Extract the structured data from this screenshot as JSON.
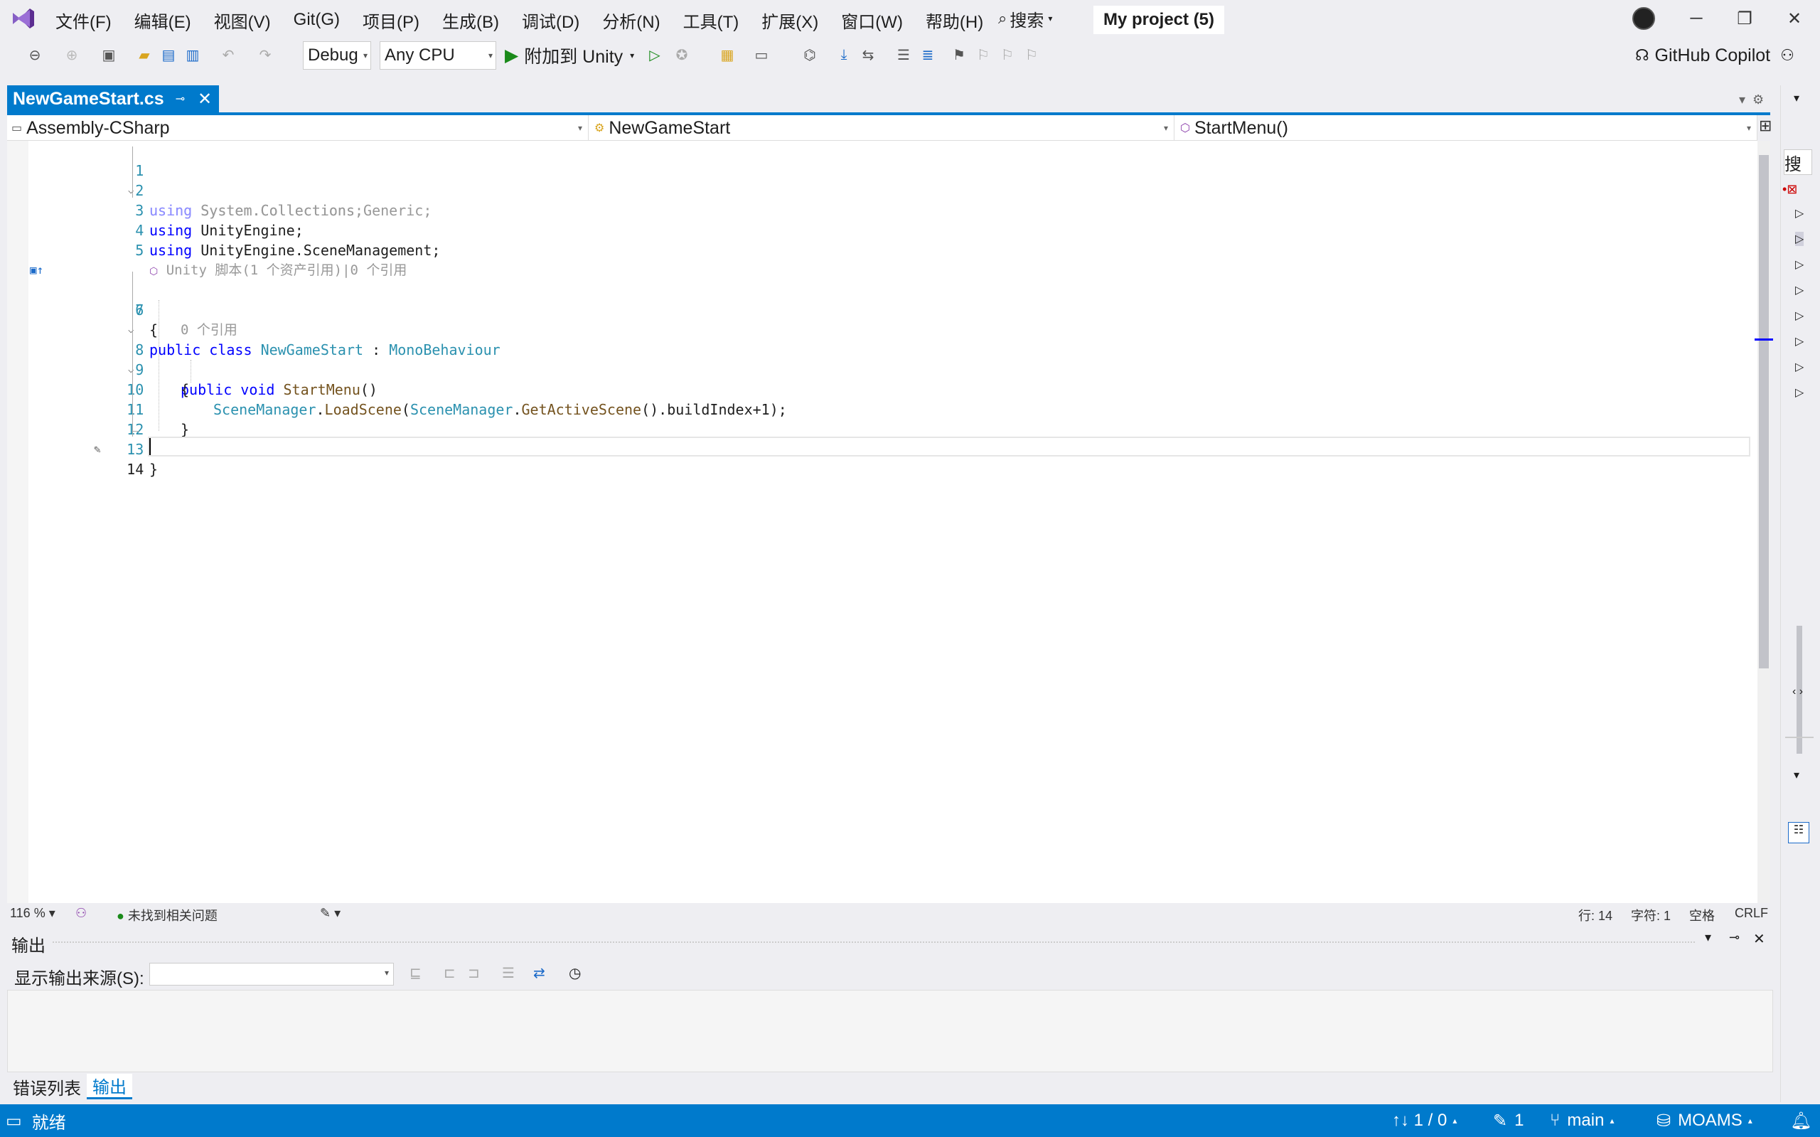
{
  "app": {
    "menu": [
      "文件(F)",
      "编辑(E)",
      "视图(V)",
      "Git(G)",
      "项目(P)",
      "生成(B)",
      "调试(D)",
      "分析(N)",
      "工具(T)",
      "扩展(X)",
      "窗口(W)",
      "帮助(H)"
    ],
    "search_label": "搜索",
    "project_name": "My project (5)",
    "window_buttons": {
      "minimize": "─",
      "restore": "❐",
      "close": "✕"
    }
  },
  "toolbar": {
    "config": "Debug",
    "platform": "Any CPU",
    "attach_label": "附加到 Unity",
    "copilot_label": "GitHub Copilot"
  },
  "tab": {
    "name": "NewGameStart.cs"
  },
  "navbar": {
    "project": "Assembly-CSharp",
    "type": "NewGameStart",
    "member": "StartMenu()"
  },
  "code": {
    "line_numbers": [
      "1",
      "2",
      "3",
      "4",
      "5",
      "6",
      "7",
      "8",
      "9",
      "10",
      "11",
      "12",
      "13",
      "14"
    ],
    "l1_kw": "using",
    "l1_rest": " System.Collections;",
    "l2_kw": "using",
    "l2_rest": " System.Collections.Generic;",
    "l3_kw": "using",
    "l3_rest": " UnityEngine;",
    "l4_kw": "using",
    "l4_rest": " UnityEngine.SceneManagement;",
    "hint_class": "Unity 脚本(1 个资产引用)|0 个引用",
    "l6_kw1": "public",
    "l6_kw2": "class",
    "l6_name": "NewGameStart",
    "l6_colon": " : ",
    "l6_base": "MonoBehaviour",
    "brace_open": "{",
    "hint_method": "0 个引用",
    "l8_kw1": "public",
    "l8_kw2": "void",
    "l8_name": "StartMenu",
    "l8_paren": "()",
    "l10_t1": "SceneManager",
    "l10_dot1": ".",
    "l10_m1": "LoadScene",
    "l10_p1": "(",
    "l10_t2": "SceneManager",
    "l10_dot2": ".",
    "l10_m2": "GetActiveScene",
    "l10_rest": "().buildIndex+1);",
    "brace_close": "}"
  },
  "editor_status": {
    "zoom": "116 %",
    "issues": "未找到相关问题",
    "line": "行: 14",
    "char": "字符: 1",
    "spacing": "空格",
    "eol": "CRLF"
  },
  "output": {
    "title": "输出",
    "source_label": "显示输出来源(S):"
  },
  "bottom_tabs": [
    "错误列表",
    "输出"
  ],
  "statusbar": {
    "ready": "就绪",
    "sync": "↑↓ 1 / 0",
    "edits": "1",
    "branch": "main",
    "repo": "MOAMS"
  },
  "colors": {
    "accent": "#007acc",
    "keyword": "#0000ff",
    "type": "#2b91af",
    "method": "#74531f"
  }
}
